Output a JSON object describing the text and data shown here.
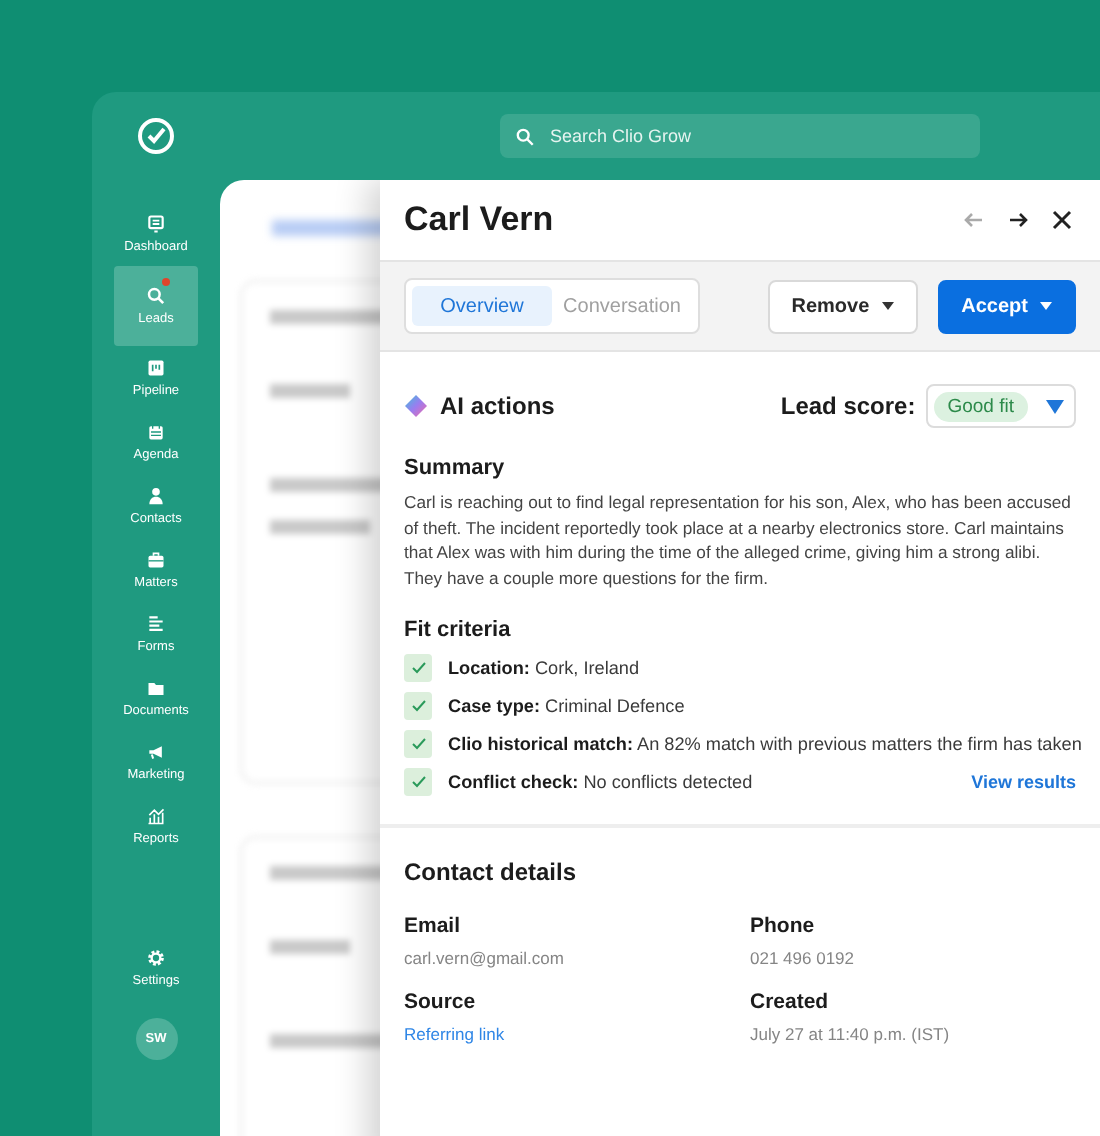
{
  "search": {
    "placeholder": "Search Clio Grow"
  },
  "sidebar": {
    "items": [
      {
        "label": "Dashboard",
        "selected": false,
        "notification": false
      },
      {
        "label": "Leads",
        "selected": true,
        "notification": true
      },
      {
        "label": "Pipeline",
        "selected": false,
        "notification": false
      },
      {
        "label": "Agenda",
        "selected": false,
        "notification": false
      },
      {
        "label": "Contacts",
        "selected": false,
        "notification": false
      },
      {
        "label": "Matters",
        "selected": false,
        "notification": false
      },
      {
        "label": "Forms",
        "selected": false,
        "notification": false
      },
      {
        "label": "Documents",
        "selected": false,
        "notification": false
      },
      {
        "label": "Marketing",
        "selected": false,
        "notification": false
      },
      {
        "label": "Reports",
        "selected": false,
        "notification": false
      }
    ],
    "settings": "Settings",
    "avatar": "SW"
  },
  "panel": {
    "title": "Carl Vern",
    "previous_disabled": true,
    "next_disabled": false,
    "tabs": [
      {
        "label": "Overview",
        "selected": true
      },
      {
        "label": "Conversation",
        "selected": false
      }
    ],
    "buttons": [
      {
        "label": "Remove",
        "kind": "secondary"
      },
      {
        "label": "Accept",
        "kind": "primary"
      }
    ],
    "ai_actions": {
      "title": "AI actions",
      "lead_score_label": "Lead score:",
      "lead_score": "Good fit"
    },
    "summary": {
      "title": "Summary",
      "text": "Carl is reaching out to find legal representation for his son, Alex, who has been accused of theft. The incident reportedly took place at a nearby electronics store. Carl maintains that Alex was with him during the time of the alleged crime, giving him a strong alibi. They have a couple more questions for the firm."
    },
    "fit_criteria": {
      "title": "Fit criteria",
      "link": "View results",
      "items": [
        {
          "label": "Location:",
          "value": "Cork, Ireland",
          "checked": true
        },
        {
          "label": "Case type:",
          "value": "Criminal Defence",
          "checked": true
        },
        {
          "label": "Clio historical match:",
          "value": "An 82% match with previous matters the firm has taken",
          "checked": true
        },
        {
          "label": "Conflict check:",
          "value": "No conflicts detected",
          "checked": true
        }
      ]
    },
    "contact_details": {
      "title": "Contact details",
      "fields": [
        {
          "label": "Email",
          "value": "carl.vern@gmail.com",
          "kind": "text"
        },
        {
          "label": "Phone",
          "value": "021 496 0192",
          "kind": "text"
        },
        {
          "label": "Source",
          "value": "Referring link",
          "kind": "link"
        },
        {
          "label": "Created",
          "value": "July 27 at 11:40 p.m. (IST)",
          "kind": "text"
        }
      ]
    }
  }
}
